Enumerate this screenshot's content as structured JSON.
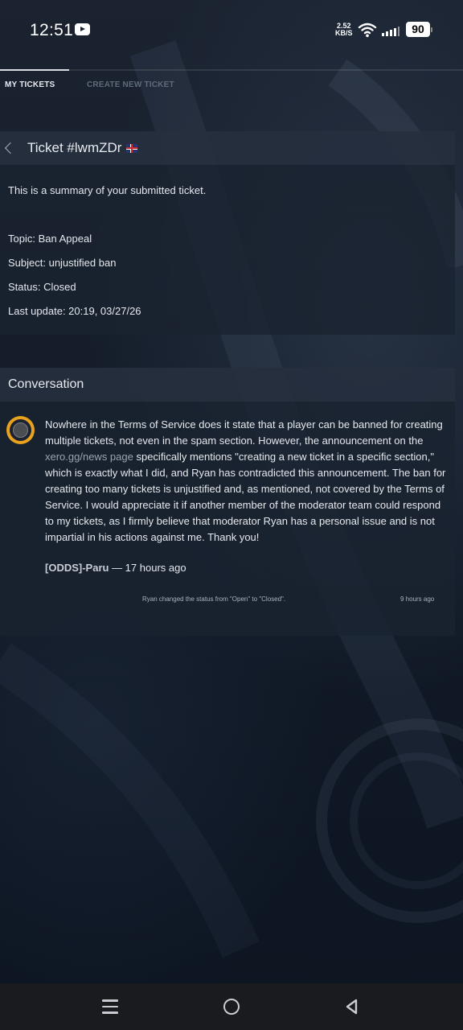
{
  "status_bar": {
    "time": "12:51",
    "net_speed_value": "2.52",
    "net_speed_unit": "KB/S",
    "battery": "90"
  },
  "tabs": [
    {
      "label": "MY TICKETS",
      "active": true
    },
    {
      "label": "CREATE NEW TICKET",
      "active": false
    }
  ],
  "ticket": {
    "title": "Ticket #lwmZDr",
    "summary": "This is a summary of your submitted ticket.",
    "topic": "Topic: Ban Appeal",
    "subject": "Subject: unjustified ban",
    "status": "Status: Closed",
    "last_update": "Last update: 20:19, 03/27/26"
  },
  "conversation": {
    "title": "Conversation",
    "message_part1": "Nowhere in the Terms of Service does it state that a player can be banned for creating multiple tickets, not even in the spam section. However, the announcement on the ",
    "message_link": "xero.gg/news page",
    "message_part2": " specifically mentions \"creating a new ticket in a specific section,\" which is exactly what I did, and Ryan has contradicted this announcement. The ban for creating too many tickets is unjustified and, as mentioned, not covered by the Terms of Service. I would appreciate it if another member of the moderator team could respond to my tickets, as I firmly believe that moderator Ryan has a personal issue and is not impartial in his actions against me. Thank you!",
    "author": "[ODDS]-Paru",
    "posted": " — 17 hours ago",
    "status_change": "Ryan changed the status from \"Open\" to \"Closed\".",
    "status_change_time": "9 hours ago"
  },
  "colors": {
    "avatar_ring": "#e8a21d",
    "background": "#121a26"
  }
}
